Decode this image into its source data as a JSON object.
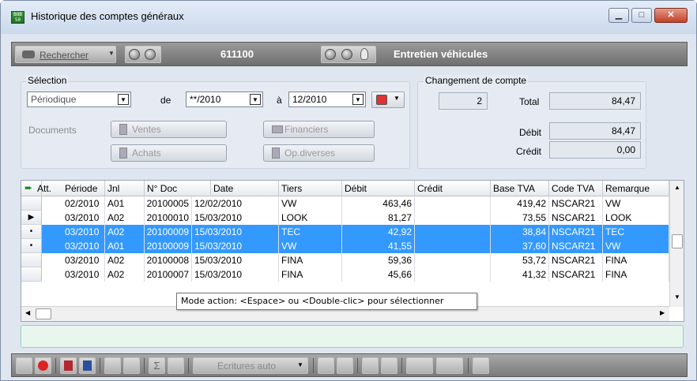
{
  "window": {
    "title": "Historique des comptes généraux",
    "icon_label": "BOB 50"
  },
  "toolbar": {
    "search_label": "Rechercher",
    "account_number": "611100",
    "account_name": "Entretien véhicules"
  },
  "selection": {
    "group_label": "Sélection",
    "mode_value": "Périodique",
    "from_label": "de",
    "from_value": "**/2010",
    "to_label": "à",
    "to_value": "12/2010",
    "documents_label": "Documents",
    "btn_ventes": "Ventes",
    "btn_achats": "Achats",
    "btn_financiers": "Financiers",
    "btn_opdiverses": "Op.diverses"
  },
  "change_account": {
    "group_label": "Changement de compte",
    "count": "2",
    "total_label": "Total",
    "total_value": "84,47",
    "debit_label": "Débit",
    "debit_value": "84,47",
    "credit_label": "Crédit",
    "credit_value": "0,00"
  },
  "table": {
    "columns": [
      "Att.",
      "Période",
      "Jnl",
      "N° Doc",
      "Date",
      "Tiers",
      "Débit",
      "Crédit",
      "Base TVA",
      "Code TVA",
      "Remarque"
    ],
    "rows": [
      {
        "marker": "",
        "periode": "02/2010",
        "jnl": "A01",
        "doc": "20100005",
        "date": "12/02/2010",
        "tiers": "VW",
        "debit": "463,46",
        "credit": "",
        "base": "419,42",
        "code": "NSCAR21",
        "remarque": "VW"
      },
      {
        "marker": "▶",
        "periode": "03/2010",
        "jnl": "A02",
        "doc": "20100010",
        "date": "15/03/2010",
        "tiers": "LOOK",
        "debit": "81,27",
        "credit": "",
        "base": "73,55",
        "code": "NSCAR21",
        "remarque": "LOOK"
      },
      {
        "marker": "•",
        "periode": "03/2010",
        "jnl": "A02",
        "doc": "20100009",
        "date": "15/03/2010",
        "tiers": "TEC",
        "debit": "42,92",
        "credit": "",
        "base": "38,84",
        "code": "NSCAR21",
        "remarque": "TEC"
      },
      {
        "marker": "•",
        "periode": "03/2010",
        "jnl": "A01",
        "doc": "20100009",
        "date": "15/03/2010",
        "tiers": "VW",
        "debit": "41,55",
        "credit": "",
        "base": "37,60",
        "code": "NSCAR21",
        "remarque": "VW"
      },
      {
        "marker": "",
        "periode": "03/2010",
        "jnl": "A02",
        "doc": "20100008",
        "date": "15/03/2010",
        "tiers": "FINA",
        "debit": "59,36",
        "credit": "",
        "base": "53,72",
        "code": "NSCAR21",
        "remarque": "FINA"
      },
      {
        "marker": "",
        "periode": "03/2010",
        "jnl": "A02",
        "doc": "20100007",
        "date": "15/03/2010",
        "tiers": "FINA",
        "debit": "45,66",
        "credit": "",
        "base": "41,32",
        "code": "NSCAR21",
        "remarque": "FINA"
      }
    ]
  },
  "tooltip": "Mode action: <Espace> ou <Double-clic> pour sélectionner",
  "bottom_toolbar": {
    "ecritures_label": "Ecritures auto"
  },
  "colors": {
    "selection": "#3399ff",
    "close_button": "#c2402a",
    "status_box": "#e8f6ee"
  }
}
